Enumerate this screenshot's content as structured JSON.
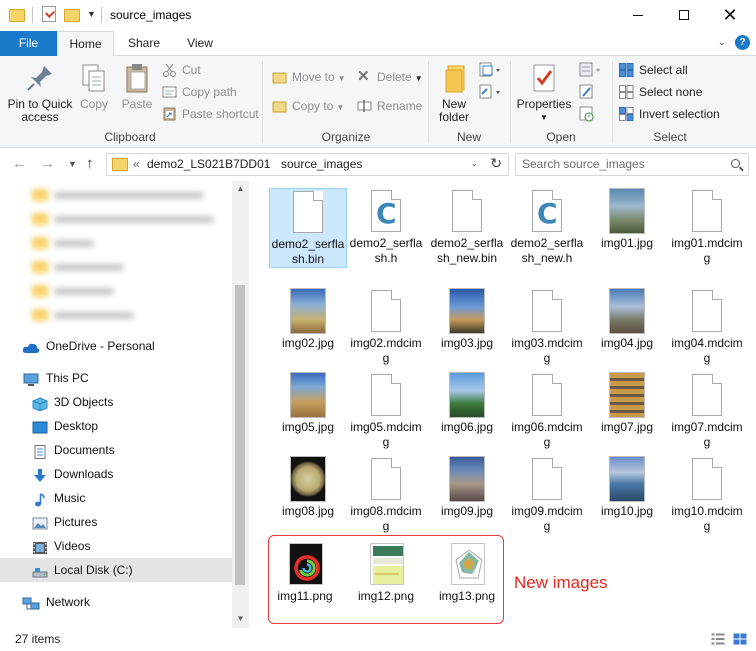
{
  "window": {
    "title": "source_images",
    "controls": [
      "minimize",
      "maximize",
      "close"
    ]
  },
  "ribbon_tabs": [
    {
      "label": "File",
      "active": false
    },
    {
      "label": "Home",
      "active": true
    },
    {
      "label": "Share",
      "active": false
    },
    {
      "label": "View",
      "active": false
    }
  ],
  "ribbon": {
    "clipboard": {
      "label": "Clipboard",
      "pin_to_quick_access": "Pin to Quick access",
      "copy": "Copy",
      "paste": "Paste",
      "cut": "Cut",
      "copy_path": "Copy path",
      "paste_shortcut": "Paste shortcut"
    },
    "organize": {
      "label": "Organize",
      "move_to": "Move to",
      "copy_to": "Copy to",
      "delete": "Delete",
      "rename": "Rename"
    },
    "new": {
      "label": "New",
      "new_folder": "New folder"
    },
    "open": {
      "label": "Open",
      "properties": "Properties"
    },
    "select": {
      "label": "Select",
      "select_all": "Select all",
      "select_none": "Select none",
      "invert_selection": "Invert selection"
    }
  },
  "address": {
    "overflow": "«",
    "crumbs": [
      "demo2_LS021B7DD01",
      "source_images"
    ],
    "search_placeholder": "Search source_images"
  },
  "nav_pane": {
    "items": [
      {
        "label": "OneDrive - Personal",
        "icon": "cloud-icon",
        "selected": false
      },
      {
        "label": "This PC",
        "icon": "computer-icon",
        "selected": false
      },
      {
        "label": "3D Objects",
        "icon": "cube-icon",
        "selected": false
      },
      {
        "label": "Desktop",
        "icon": "desktop-icon",
        "selected": false
      },
      {
        "label": "Documents",
        "icon": "document-icon",
        "selected": false
      },
      {
        "label": "Downloads",
        "icon": "download-icon",
        "selected": false
      },
      {
        "label": "Music",
        "icon": "music-icon",
        "selected": false
      },
      {
        "label": "Pictures",
        "icon": "pictures-icon",
        "selected": false
      },
      {
        "label": "Videos",
        "icon": "videos-icon",
        "selected": false
      },
      {
        "label": "Local Disk (C:)",
        "icon": "drive-icon",
        "selected": true
      },
      {
        "label": "Network",
        "icon": "network-icon",
        "selected": false
      }
    ]
  },
  "files": [
    {
      "name": "demo2_serflash.bin",
      "type": "doc",
      "selected": true
    },
    {
      "name": "demo2_serflash.h",
      "type": "c"
    },
    {
      "name": "demo2_serflash_new.bin",
      "type": "doc"
    },
    {
      "name": "demo2_serflash_new.h",
      "type": "c"
    },
    {
      "name": "img01.jpg",
      "type": "photo"
    },
    {
      "name": "img01.mdcimg",
      "type": "doc"
    },
    {
      "name": "img02.jpg",
      "type": "photo"
    },
    {
      "name": "img02.mdcimg",
      "type": "doc"
    },
    {
      "name": "img03.jpg",
      "type": "photo"
    },
    {
      "name": "img03.mdcimg",
      "type": "doc"
    },
    {
      "name": "img04.jpg",
      "type": "photo"
    },
    {
      "name": "img04.mdcimg",
      "type": "doc"
    },
    {
      "name": "img05.jpg",
      "type": "photo"
    },
    {
      "name": "img05.mdcimg",
      "type": "doc"
    },
    {
      "name": "img06.jpg",
      "type": "photo"
    },
    {
      "name": "img06.mdcimg",
      "type": "doc"
    },
    {
      "name": "img07.jpg",
      "type": "photo"
    },
    {
      "name": "img07.mdcimg",
      "type": "doc"
    },
    {
      "name": "img08.jpg",
      "type": "photo"
    },
    {
      "name": "img08.mdcimg",
      "type": "doc"
    },
    {
      "name": "img09.jpg",
      "type": "photo"
    },
    {
      "name": "img09.mdcimg",
      "type": "doc"
    },
    {
      "name": "img10.jpg",
      "type": "photo"
    },
    {
      "name": "img10.mdcimg",
      "type": "doc"
    },
    {
      "name": "img11.png",
      "type": "png"
    },
    {
      "name": "img12.png",
      "type": "png"
    },
    {
      "name": "img13.png",
      "type": "png"
    }
  ],
  "annotation": {
    "text": "New images",
    "color": "#e8291f"
  },
  "status": {
    "item_count": "27 items"
  },
  "colors": {
    "accent": "#1979ca",
    "selection": "#cce8ff",
    "folder": "#f7d46a"
  }
}
